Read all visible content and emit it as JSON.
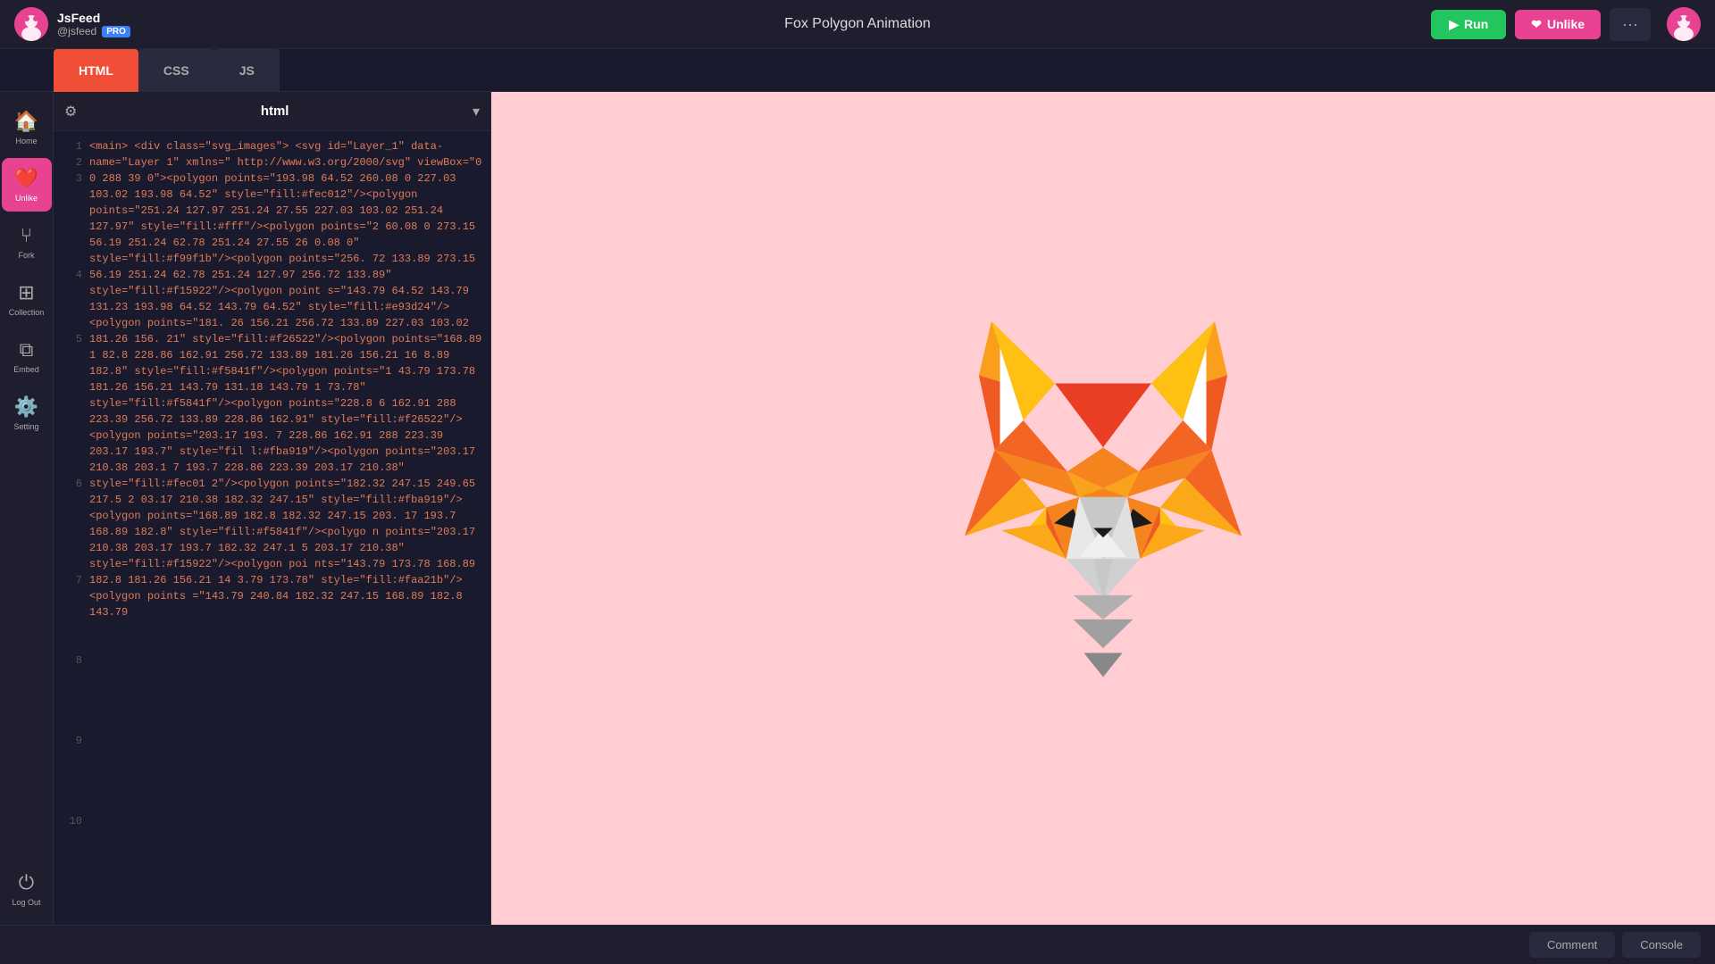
{
  "app": {
    "name": "JsFeed",
    "handle": "@jsfeed",
    "pro_badge": "PRO",
    "title": "Fox Polygon Animation"
  },
  "topbar": {
    "run_label": "Run",
    "unlike_label": "Unlike",
    "more_label": "···"
  },
  "tabs": [
    {
      "label": "HTML",
      "active": true
    },
    {
      "label": "CSS",
      "active": false
    },
    {
      "label": "JS",
      "active": false
    }
  ],
  "sidebar": {
    "items": [
      {
        "label": "Home",
        "icon": "🏠"
      },
      {
        "label": "Unlike",
        "icon": "❤️",
        "active": true
      },
      {
        "label": "Fork",
        "icon": "🍴"
      },
      {
        "label": "Collection",
        "icon": "⊞"
      },
      {
        "label": "Embed",
        "icon": "⎇"
      },
      {
        "label": "Setting",
        "icon": "⚙️"
      },
      {
        "label": "Log Out",
        "icon": "⏻"
      }
    ]
  },
  "editor": {
    "title": "html",
    "language": "html"
  },
  "bottombar": {
    "comment_label": "Comment",
    "console_label": "Console"
  },
  "code_content": "<main>\n    <div class=\"svg_images\">\n        <svg id=\"Layer_1\" data-name=\"Layer 1\" xmlns=\n\"http://www.w3.org/2000/svg\" viewBox=\"0 0 288 39\n0\"><polygon points=\"193.98 64.52 260.08 0 227.03\n103.02 193.98 64.52\" style=\"fill:#fec012\"/><polygon\npoints=\"251.24 127.97 251.24 27.55 227.03 103.02\n251.24 127.97\" style=\"fill:#fff\"/><polygon points=\"2\n60.08 0 273.15 56.19 251.24 62.78 251.24 27.55 26\n0.08 0\" style=\"fill:#f99f1b\"/><polygon points=\"256.\n72 133.89 273.15 56.19 251.24 62.78 251.24 127.97\n256.72 133.89\" style=\"fill:#f15922\"/><polygon point\ns=\"143.79 64.52 143.79 131.23 193.98 64.52 143.79\n64.52\" style=\"fill:#e93d24\"/><polygon points=\"181.\n26 156.21 256.72 133.89 227.03 103.02 181.26 156.\n21\" style=\"fill:#f26522\"/><polygon points=\"168.89 1\n82.8 228.86 162.91 256.72 133.89 181.26 156.21 16\n8.89 182.8\" style=\"fill:#f5841f\"/><polygon points=\"1\n43.79 173.78 181.26 156.21 143.79 131.18 143.79 1\n73.78\" style=\"fill:#f5841f\"/><polygon points=\"228.8\n6 162.91 288 223.39 256.72 133.89 228.86 162.91\"\nstyle=\"fill:#f26522\"/><polygon points=\"203.17 193.\n7 228.86 162.91 288 223.39 203.17 193.7\" style=\"fil\nl:#fba919\"/><polygon points=\"203.17 210.38 203.1\n7 193.7 228.86 223.39 203.17 210.38\" style=\"fill:#fec01\n2\"/><polygon points=\"182.32 247.15 249.65 217.5 2\n03.17 210.38 182.32 247.15\" style=\"fill:#fba919\"/>\n<polygon points=\"168.89 182.8 182.32 247.15 203.\n17 193.7 168.89 182.8\" style=\"fill:#f5841f\"/><polygo\nn points=\"203.17 210.38 203.17 193.7 182.32 247.1\n5 203.17 210.38\" style=\"fill:#f15922\"/><polygon poi\nnts=\"143.79 173.78 168.89 182.8 181.26 156.21 14\n3.79 173.78\" style=\"fill:#faa21b\"/><polygon points\n=\"143.79 240.84 182.32 247.15 168.89 182.8 143.79"
}
